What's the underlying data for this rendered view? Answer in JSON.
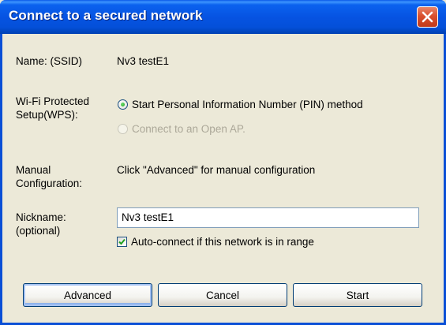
{
  "window": {
    "title": "Connect to a secured network",
    "close_icon": "close-icon"
  },
  "name_row": {
    "label": "Name:  (SSID)",
    "value": "Nv3 testE1"
  },
  "wps": {
    "label_line1": "Wi-Fi Protected",
    "label_line2": "Setup(WPS):",
    "options": [
      {
        "label": "Start Personal Information Number (PIN) method",
        "selected": true,
        "enabled": true
      },
      {
        "label": "Connect to an Open AP.",
        "selected": false,
        "enabled": false
      }
    ]
  },
  "manual": {
    "label_line1": "Manual",
    "label_line2": "Configuration:",
    "text": "Click \"Advanced\" for manual configuration"
  },
  "nickname": {
    "label_line1": "Nickname:",
    "label_line2": "(optional)",
    "value": "Nv3 testE1"
  },
  "auto_connect": {
    "label": "Auto-connect if this network is in range",
    "checked": true
  },
  "buttons": {
    "advanced": "Advanced",
    "cancel": "Cancel",
    "start": "Start"
  },
  "colors": {
    "titlebar": "#0653e2",
    "dialog_bg": "#ece9d8",
    "close_button": "#d9502e"
  }
}
